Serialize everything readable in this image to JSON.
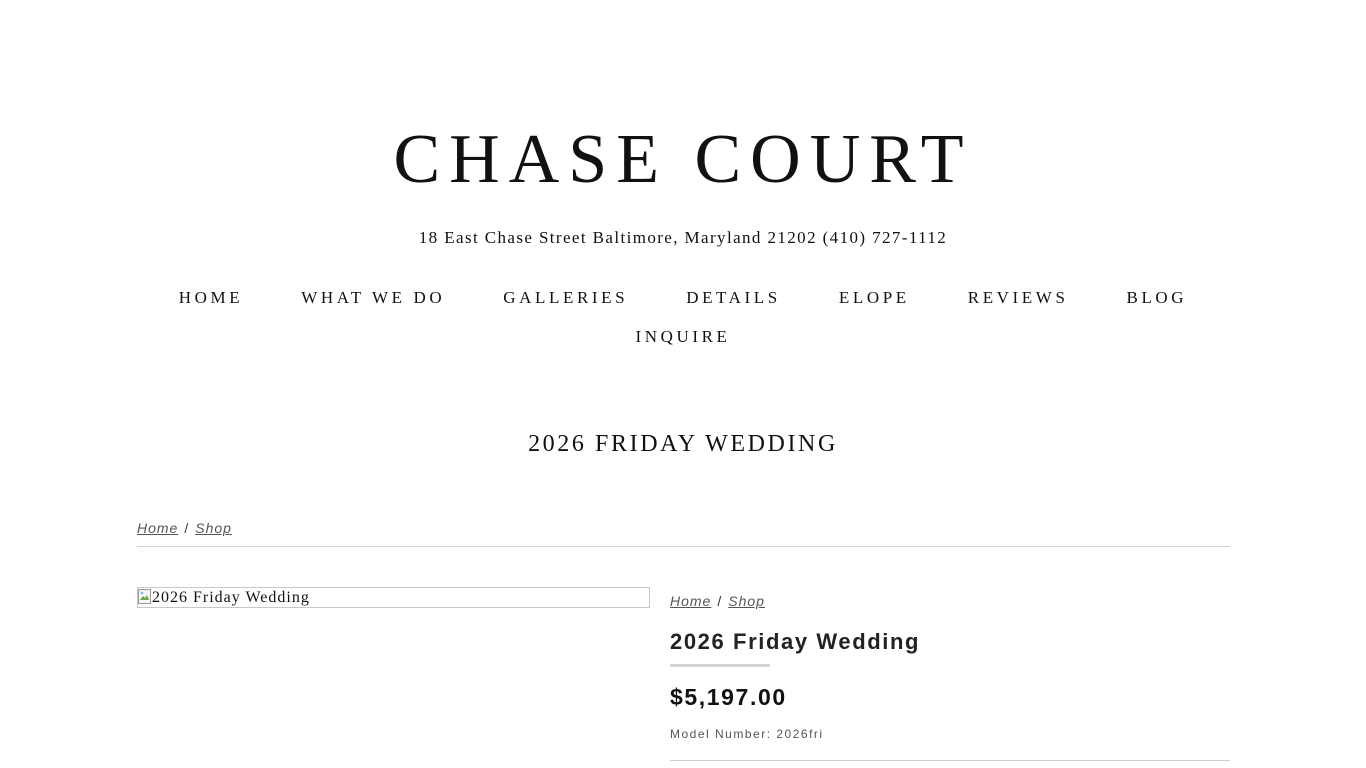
{
  "site": {
    "title": "CHASE COURT",
    "address": "18 East Chase Street Baltimore, Maryland 21202 (410) 727-1112"
  },
  "nav": {
    "items": [
      {
        "label": "HOME"
      },
      {
        "label": "WHAT WE DO"
      },
      {
        "label": "GALLERIES"
      },
      {
        "label": "DETAILS"
      },
      {
        "label": "ELOPE"
      },
      {
        "label": "REVIEWS"
      },
      {
        "label": "BLOG"
      },
      {
        "label": "INQUIRE"
      }
    ]
  },
  "page": {
    "title": "2026 FRIDAY WEDDING"
  },
  "breadcrumb": {
    "home": "Home",
    "separator": "/",
    "shop": "Shop"
  },
  "product": {
    "image_alt": "2026 Friday Wedding",
    "image_icon": "broken-image-icon",
    "title": "2026 Friday Wedding",
    "price": "$5,197.00",
    "model_label": "Model Number:",
    "model_value": "2026fri"
  }
}
